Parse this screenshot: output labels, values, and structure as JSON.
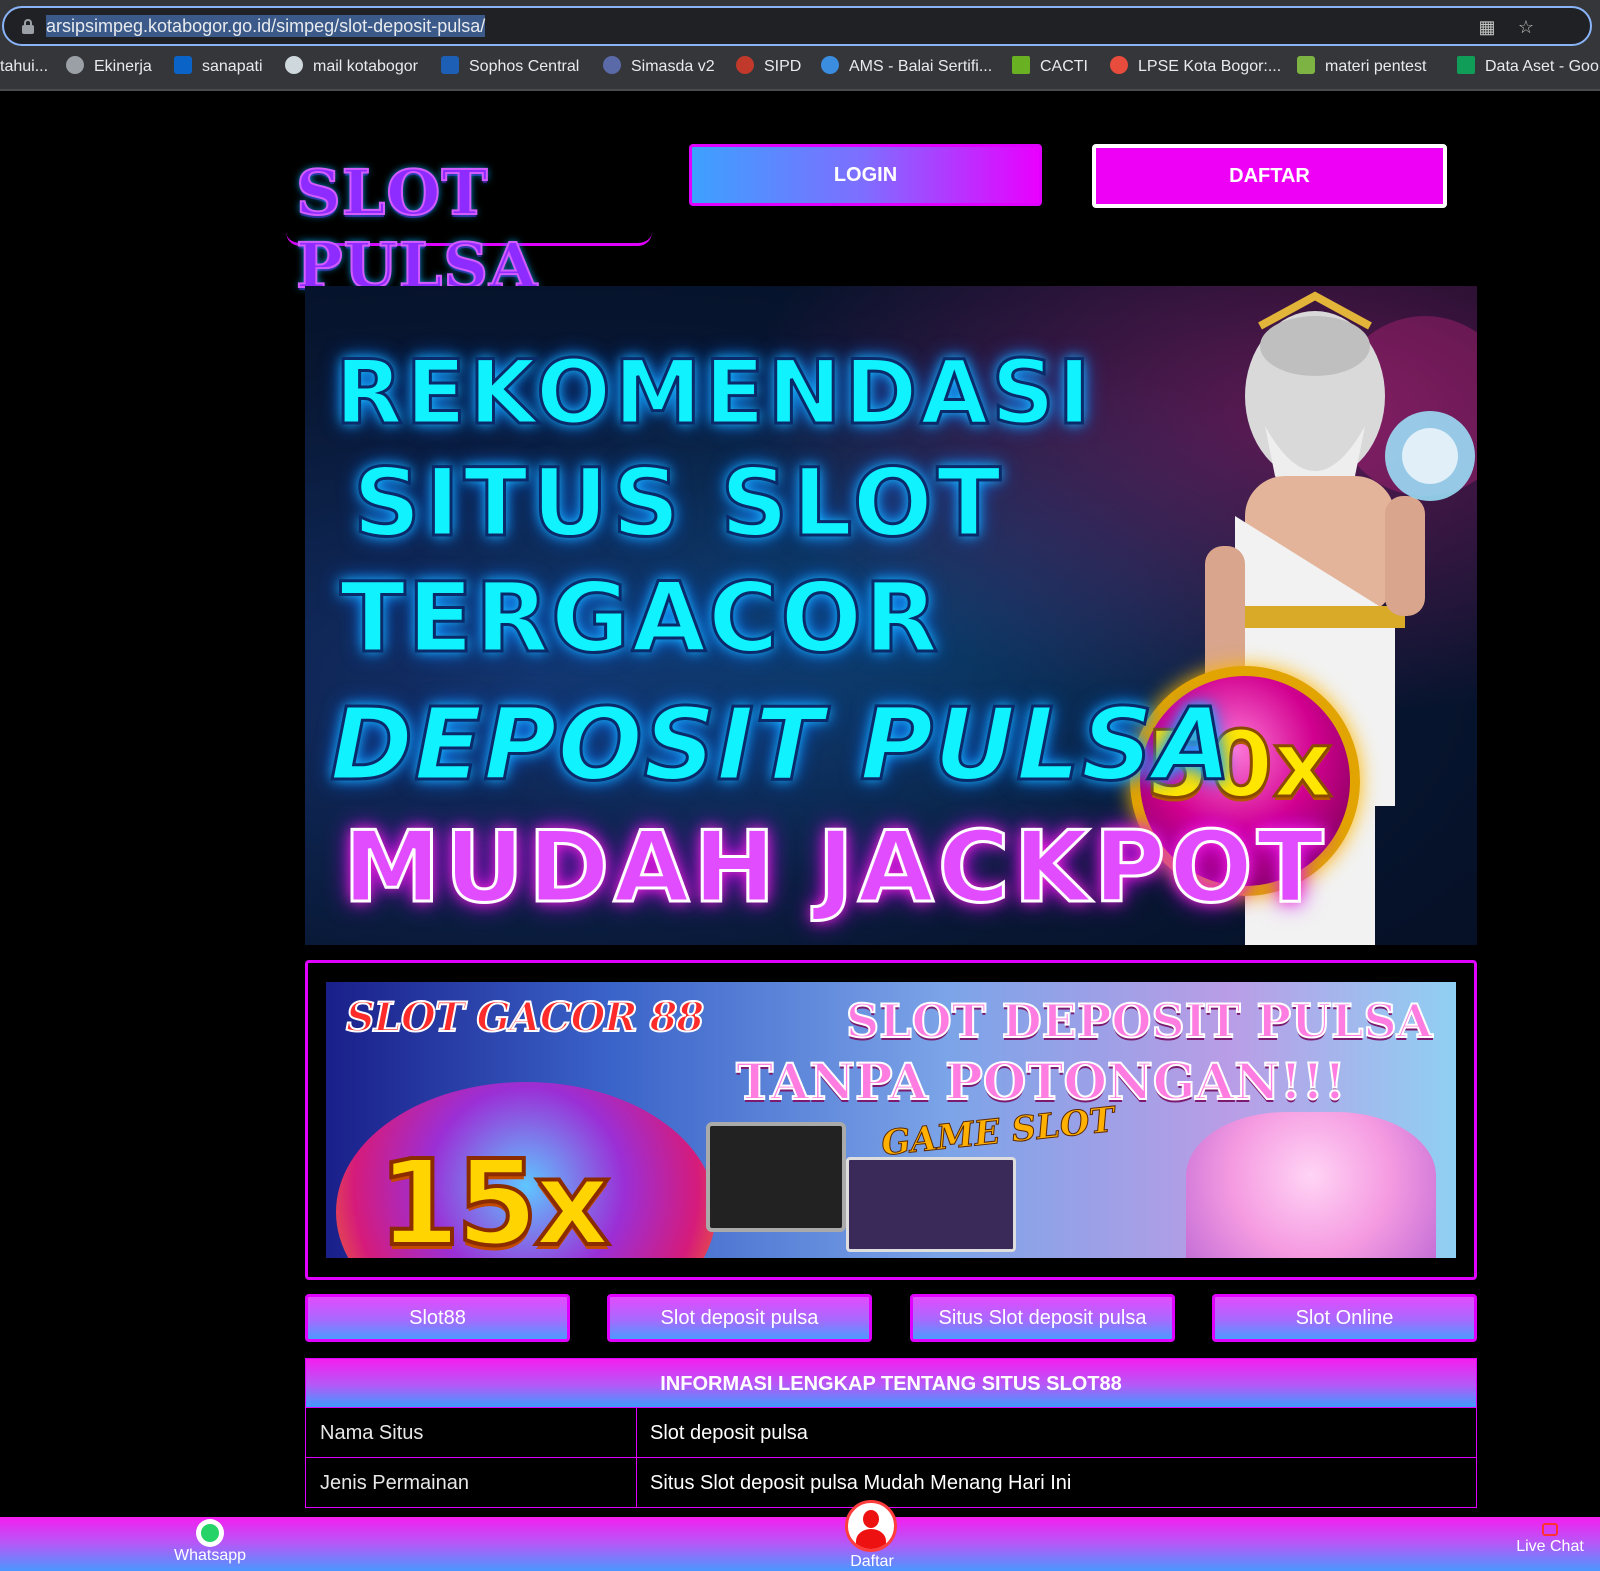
{
  "browser": {
    "url_host": "arsipsimpeg.kotabogor.go.id",
    "url_path": "/simpeg/slot-deposit-pulsa/",
    "bookmarks": [
      {
        "label": "tahui...",
        "icon": "truncated-bookmark"
      },
      {
        "label": "Ekinerja",
        "icon": "globe-icon"
      },
      {
        "label": "sanapati",
        "icon": "outlook-icon"
      },
      {
        "label": "mail kotabogor",
        "icon": "mail-icon"
      },
      {
        "label": "Sophos Central",
        "icon": "sophos-icon"
      },
      {
        "label": "Simasda v2",
        "icon": "simasda-icon"
      },
      {
        "label": "SIPD",
        "icon": "sipd-icon"
      },
      {
        "label": "AMS - Balai Sertifi...",
        "icon": "ams-icon"
      },
      {
        "label": "CACTI",
        "icon": "cacti-icon"
      },
      {
        "label": "LPSE Kota Bogor:...",
        "icon": "lpse-icon"
      },
      {
        "label": "materi pentest",
        "icon": "pentest-icon"
      },
      {
        "label": "Data Aset - Goo",
        "icon": "sheets-icon"
      }
    ]
  },
  "header": {
    "logo_text": "SLOT PULSA",
    "login_label": "LOGIN",
    "daftar_label": "DAFTAR"
  },
  "hero": {
    "line1": "REKOMENDASI",
    "line2": "SITUS SLOT",
    "line3": "TERGACOR",
    "line4": "DEPOSIT PULSA",
    "line5": "MUDAH JACKPOT",
    "badge": "50x"
  },
  "banner2": {
    "title_left": "SLOT GACOR 88",
    "title_right_1": "SLOT DEPOSIT PULSA",
    "title_right_2": "TANPA POTONGAN!!!",
    "multiplier": "15x",
    "game_slot": "GAME SLOT"
  },
  "nav": [
    {
      "label": "Slot88"
    },
    {
      "label": "Slot deposit pulsa"
    },
    {
      "label": "Situs Slot deposit pulsa"
    },
    {
      "label": "Slot Online"
    }
  ],
  "info": {
    "header": "INFORMASI LENGKAP TENTANG SITUS SLOT88",
    "rows": [
      {
        "label": "Nama Situs",
        "value": "Slot deposit pulsa"
      },
      {
        "label": "Jenis Permainan",
        "value": "Situs Slot deposit pulsa Mudah Menang Hari Ini"
      }
    ]
  },
  "bottom_bar": {
    "whatsapp": "Whatsapp",
    "daftar": "Daftar",
    "live_chat": "Live Chat"
  },
  "colors": {
    "accent_magenta": "#e000ff",
    "accent_blue": "#3da0ff",
    "background": "#000000"
  }
}
